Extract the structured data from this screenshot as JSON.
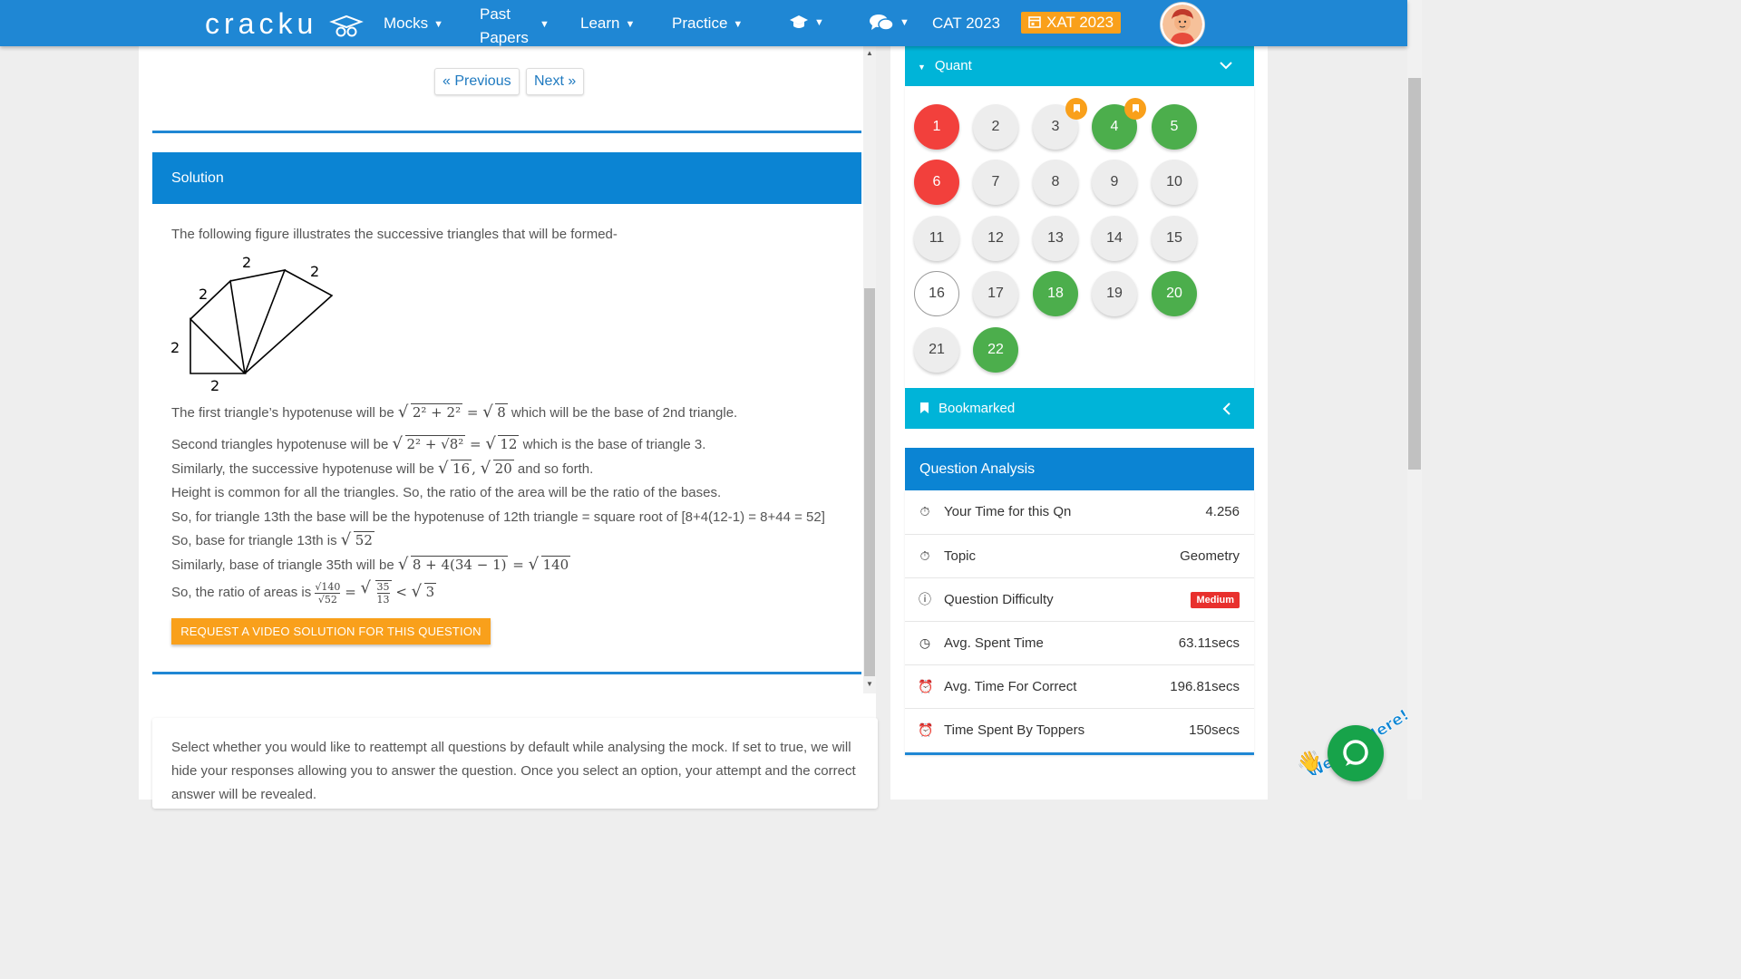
{
  "nav": {
    "logo": "cracku",
    "items": [
      {
        "label": "Mocks"
      },
      {
        "label_line1": "Past",
        "label_line2": "Papers"
      },
      {
        "label": "Learn"
      },
      {
        "label": "Practice"
      }
    ],
    "cat": "CAT 2023",
    "xat": "XAT 2023"
  },
  "pagination": {
    "previous": "« Previous",
    "next": "Next »"
  },
  "solution": {
    "heading": "Solution",
    "intro": "The following figure illustrates the successive triangles that will be formed-",
    "figure_labels": [
      "2",
      "2",
      "2",
      "2",
      "2"
    ],
    "line1_a": "The first triangle’s hypotenuse will be ",
    "line1_math": "2² + 2²",
    "line1_eq": " = ",
    "line1_root": "8",
    "line1_b": " which will be the base of 2nd triangle.",
    "line2_a": "Second triangles hypotenuse will be ",
    "line2_math": "2² + √8²",
    "line2_root": "12",
    "line2_b": " which is the base of triangle 3.",
    "line3_a": "Similarly, the successive hypotenuse will be ",
    "line3_r1": "16",
    "line3_r2": "20",
    "line3_b": " and so forth.",
    "line4": "Height is common for all the triangles. So, the ratio of the area will be the ratio of the bases.",
    "line5": "So, for triangle 13th the base will be the hypotenuse of 12th triangle = square root of [8+4(12-1) = 8+44 = 52]",
    "line6_a": "So, base for triangle 13th is ",
    "line6_root": "52",
    "line7_a": "Similarly, base of triangle 35th will be ",
    "line7_math": "8 + 4(34 − 1)",
    "line7_root": "140",
    "line8_a": "So, the ratio of areas is ",
    "line8_num": "√140",
    "line8_den": "√52",
    "line8_frac_num": "35",
    "line8_frac_den": "13",
    "line8_lt": " < ",
    "line8_root": "3",
    "request_button": "REQUEST A VIDEO SOLUTION FOR THIS QUESTION"
  },
  "reattempt_text": "Select whether you would like to reattempt all questions by default while analysing the mock. If set to true, we will hide your responses allowing you to answer the question. Once you select an option, your attempt and the correct answer will be revealed.",
  "quant": {
    "heading": "Quant",
    "questions": [
      {
        "n": "1",
        "status": "red"
      },
      {
        "n": "2",
        "status": "grey"
      },
      {
        "n": "3",
        "status": "grey",
        "bookmarked": true
      },
      {
        "n": "4",
        "status": "green",
        "bookmarked": true
      },
      {
        "n": "5",
        "status": "green"
      },
      {
        "n": "6",
        "status": "red"
      },
      {
        "n": "7",
        "status": "grey"
      },
      {
        "n": "8",
        "status": "grey"
      },
      {
        "n": "9",
        "status": "grey"
      },
      {
        "n": "10",
        "status": "grey"
      },
      {
        "n": "11",
        "status": "grey"
      },
      {
        "n": "12",
        "status": "grey"
      },
      {
        "n": "13",
        "status": "grey"
      },
      {
        "n": "14",
        "status": "grey"
      },
      {
        "n": "15",
        "status": "grey"
      },
      {
        "n": "16",
        "status": "outline"
      },
      {
        "n": "17",
        "status": "grey"
      },
      {
        "n": "18",
        "status": "green"
      },
      {
        "n": "19",
        "status": "grey"
      },
      {
        "n": "20",
        "status": "green"
      },
      {
        "n": "21",
        "status": "grey"
      },
      {
        "n": "22",
        "status": "green"
      }
    ]
  },
  "bookmarked": {
    "heading": "Bookmarked"
  },
  "analysis": {
    "heading": "Question Analysis",
    "rows": [
      {
        "label": "Your Time for this Qn",
        "value": "4.256",
        "icon": "stopwatch-icon"
      },
      {
        "label": "Topic",
        "value": "Geometry",
        "icon": "stopwatch-icon"
      },
      {
        "label": "Question Difficulty",
        "value": "Medium",
        "icon": "help-circle-icon"
      },
      {
        "label": "Avg. Spent Time",
        "value": "63.11secs",
        "icon": "clock-icon"
      },
      {
        "label": "Avg. Time For Correct",
        "value": "196.81secs",
        "icon": "alarm-icon"
      },
      {
        "label": "Time Spent By Toppers",
        "value": "150secs",
        "icon": "alarm-icon"
      }
    ]
  },
  "chat_widget": {
    "caption": "We Are Here!"
  },
  "colors": {
    "primary": "#1f87d4",
    "accent_orange": "#f9a01b",
    "cyan": "#00b4d8",
    "correct": "#4cae4c",
    "wrong": "#f2403c"
  }
}
